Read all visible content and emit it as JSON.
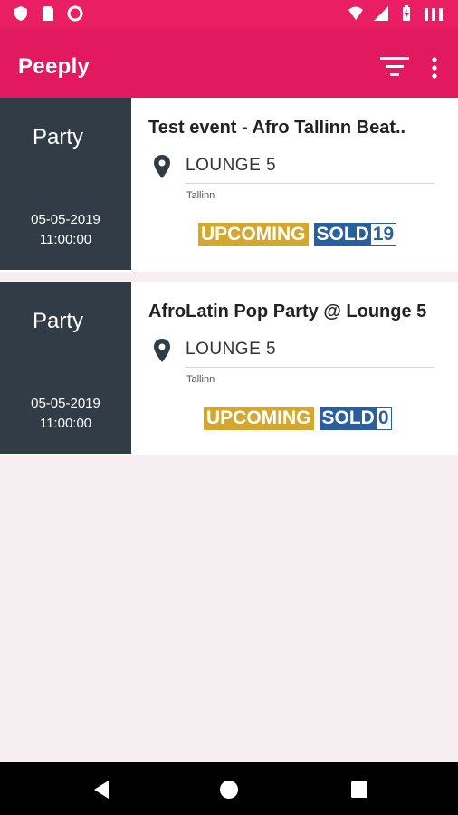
{
  "app": {
    "title": "Peeply",
    "colors": {
      "primary": "#e2195f",
      "status_bar": "#e91e63",
      "card_dark": "#323c47",
      "upcoming": "#d4a82e",
      "sold": "#2a5f9e",
      "background": "#f7eef1"
    }
  },
  "status_bar": {
    "left_icons": [
      "shield-icon",
      "sim-card-icon",
      "circle-icon"
    ],
    "right_icons": [
      "wifi-icon",
      "signal-icon",
      "battery-charging-icon",
      "signal-bars-icon"
    ]
  },
  "toolbar": {
    "filter_icon": "filter-icon",
    "menu_icon": "more-vert-icon"
  },
  "events": [
    {
      "category": "Party",
      "date": "05-05-2019",
      "time": "11:00:00",
      "title": "Test event - Afro Tallinn Beat..",
      "venue": "LOUNGE 5",
      "city": "Tallinn",
      "status": "UPCOMING",
      "sold_label": "SOLD",
      "sold_count": "19"
    },
    {
      "category": "Party",
      "date": "05-05-2019",
      "time": "11:00:00",
      "title": "AfroLatin Pop Party @ Lounge 5",
      "venue": "LOUNGE 5",
      "city": "Tallinn",
      "status": "UPCOMING",
      "sold_label": "SOLD",
      "sold_count": "0"
    }
  ],
  "nav_bar": {
    "buttons": [
      "back-icon",
      "home-icon",
      "recents-icon"
    ]
  }
}
